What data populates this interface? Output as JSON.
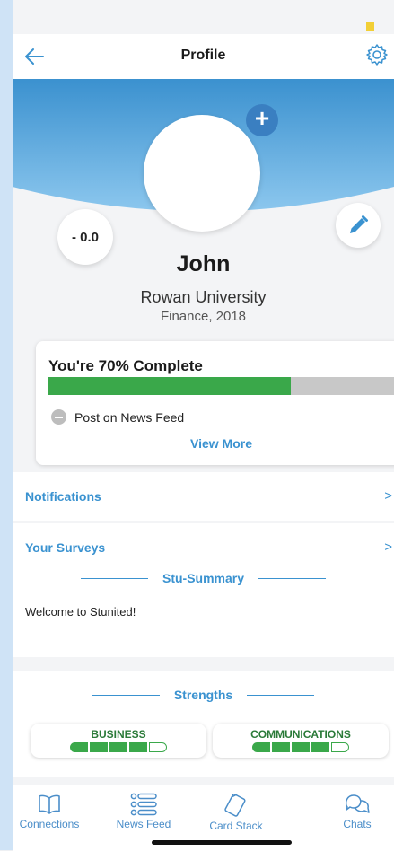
{
  "header": {
    "title": "Profile"
  },
  "profile": {
    "rating": "- 0.0",
    "name": "John",
    "school": "Rowan University",
    "major": "Finance, 2018"
  },
  "completion": {
    "title": "You're 70% Complete",
    "percent": 70,
    "task": "Post on News Feed",
    "view_more": "View More"
  },
  "rows": {
    "notifications": "Notifications",
    "surveys": "Your Surveys",
    "chevron": ">"
  },
  "summary": {
    "title": "Stu-Summary",
    "text": "Welcome to Stunited!"
  },
  "strengths": {
    "title": "Strengths",
    "items": [
      {
        "label": "BUSINESS",
        "level": 4,
        "max": 5
      },
      {
        "label": "COMMUNICATIONS",
        "level": 4,
        "max": 5
      }
    ]
  },
  "tabs": [
    {
      "label": "Connections",
      "icon": "book-icon"
    },
    {
      "label": "News Feed",
      "icon": "list-icon"
    },
    {
      "label": "Card Stack",
      "icon": "cards-icon"
    },
    {
      "label": "Chats",
      "icon": "chat-icon"
    }
  ],
  "colors": {
    "accent": "#3a92d0",
    "success": "#3aa84a",
    "plus": "#3a7fc1"
  }
}
